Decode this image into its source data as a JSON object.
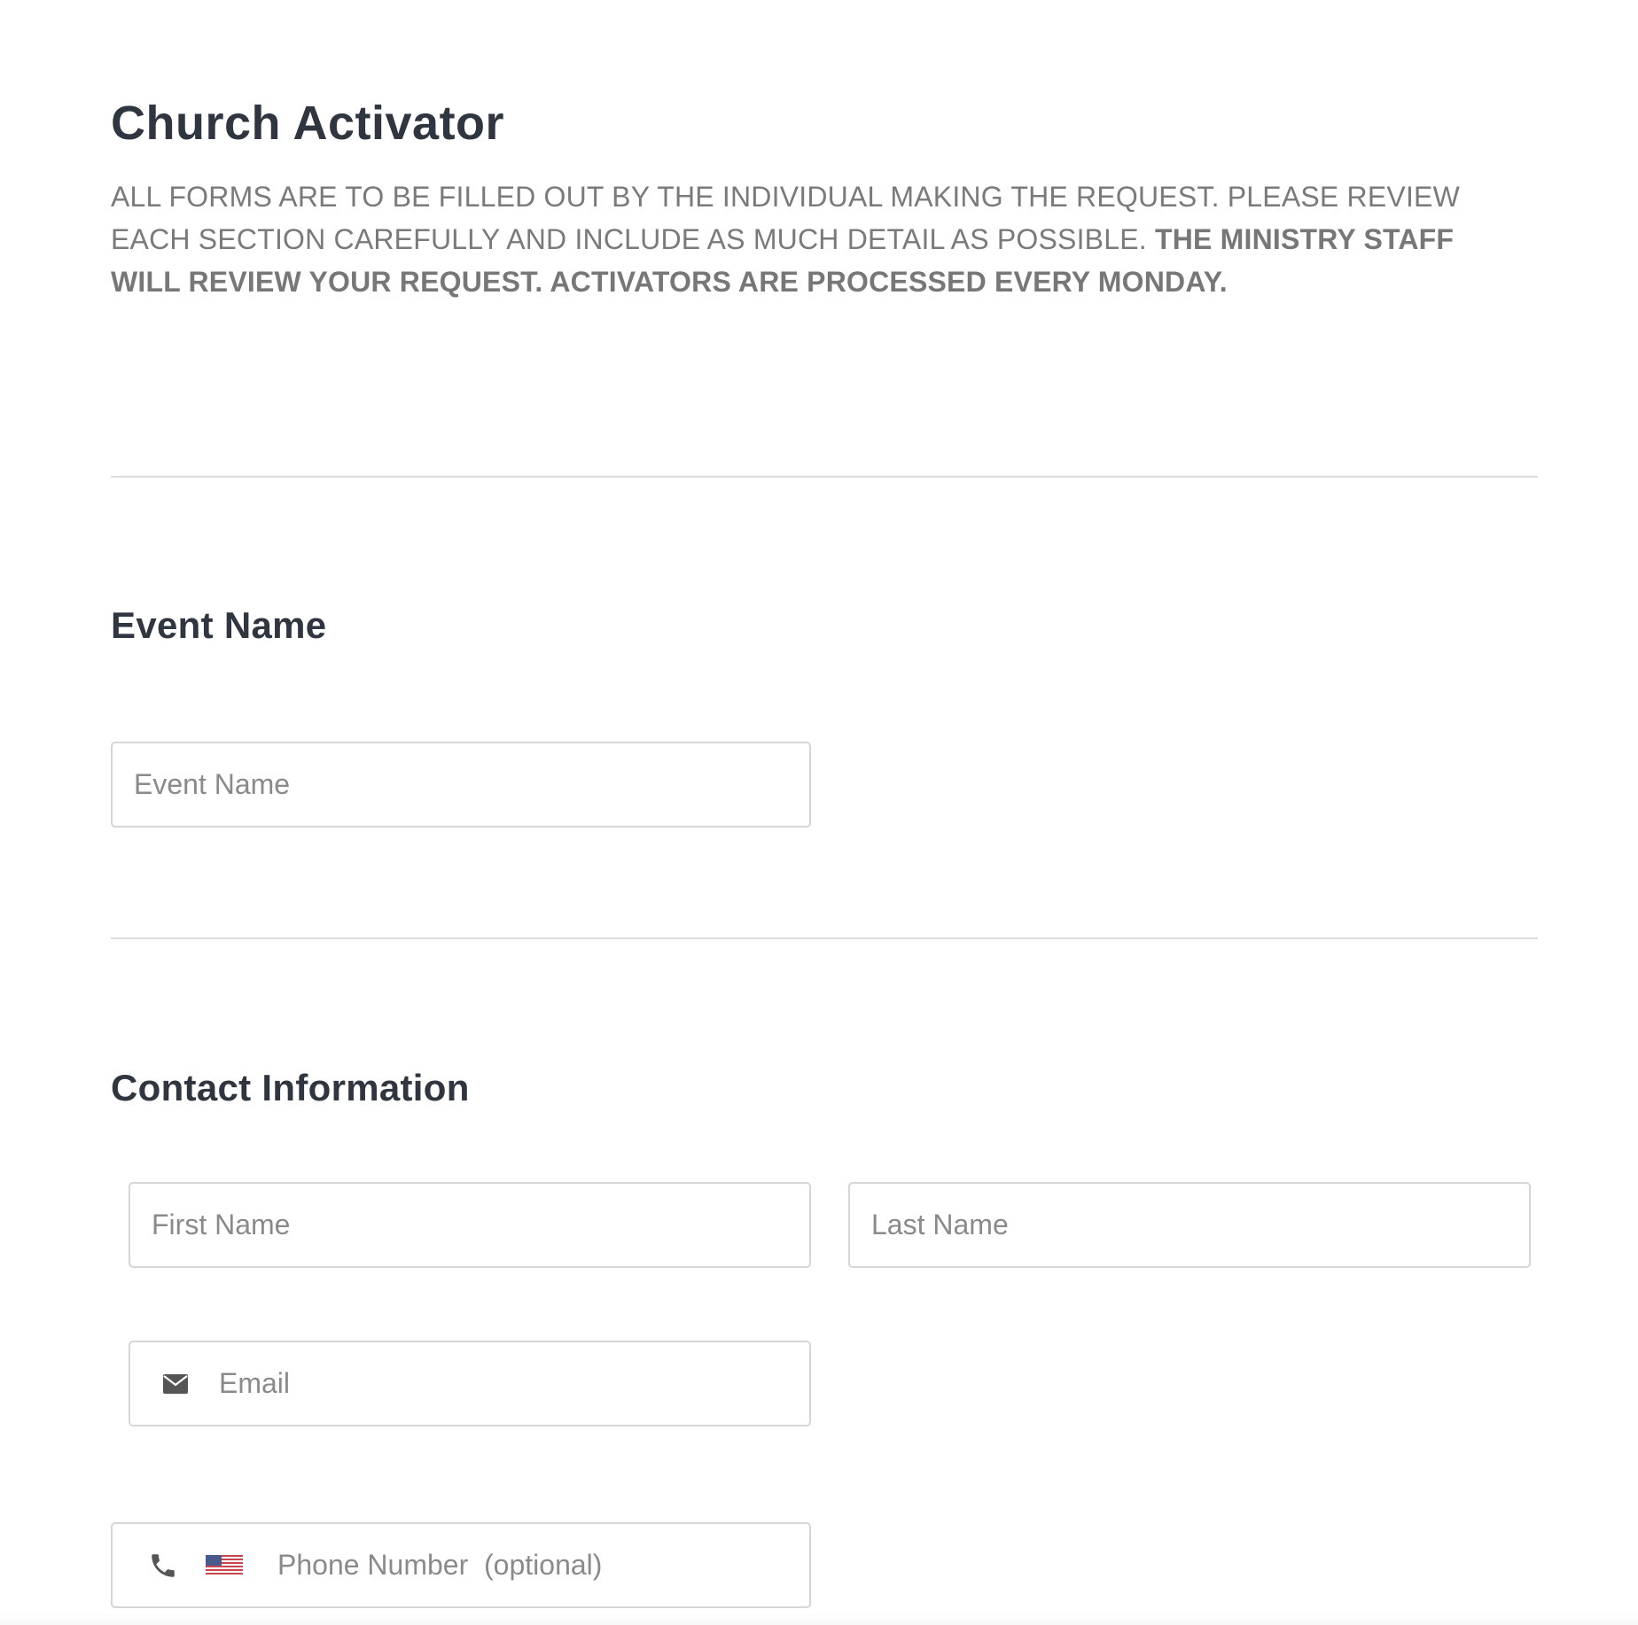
{
  "form": {
    "title": "Church Activator",
    "intro_text": "ALL FORMS ARE TO BE FILLED OUT BY THE INDIVIDUAL MAKING THE REQUEST. PLEASE REVIEW EACH SECTION CAREFULLY AND INCLUDE AS MUCH DETAIL AS POSSIBLE. ",
    "intro_bold": "THE MINISTRY STAFF WILL REVIEW YOUR REQUEST. ACTIVATORS ARE PROCESSED EVERY MONDAY."
  },
  "event_section": {
    "label": "Event Name",
    "event_name": {
      "placeholder": "Event Name",
      "value": ""
    }
  },
  "contact_section": {
    "label": "Contact Information",
    "first_name": {
      "placeholder": "First Name",
      "value": ""
    },
    "last_name": {
      "placeholder": "Last Name",
      "value": ""
    },
    "email": {
      "placeholder": "Email",
      "value": "",
      "icon": "envelope-icon"
    },
    "phone": {
      "placeholder": "Phone Number  (optional)",
      "value": "",
      "icon": "phone-icon",
      "country_flag": "us-flag-icon"
    }
  },
  "colors": {
    "heading": "#2f3640",
    "body_text": "#7a7a7a",
    "border": "#d6d6d6",
    "placeholder": "#8a8a8a",
    "icon": "#555555"
  }
}
